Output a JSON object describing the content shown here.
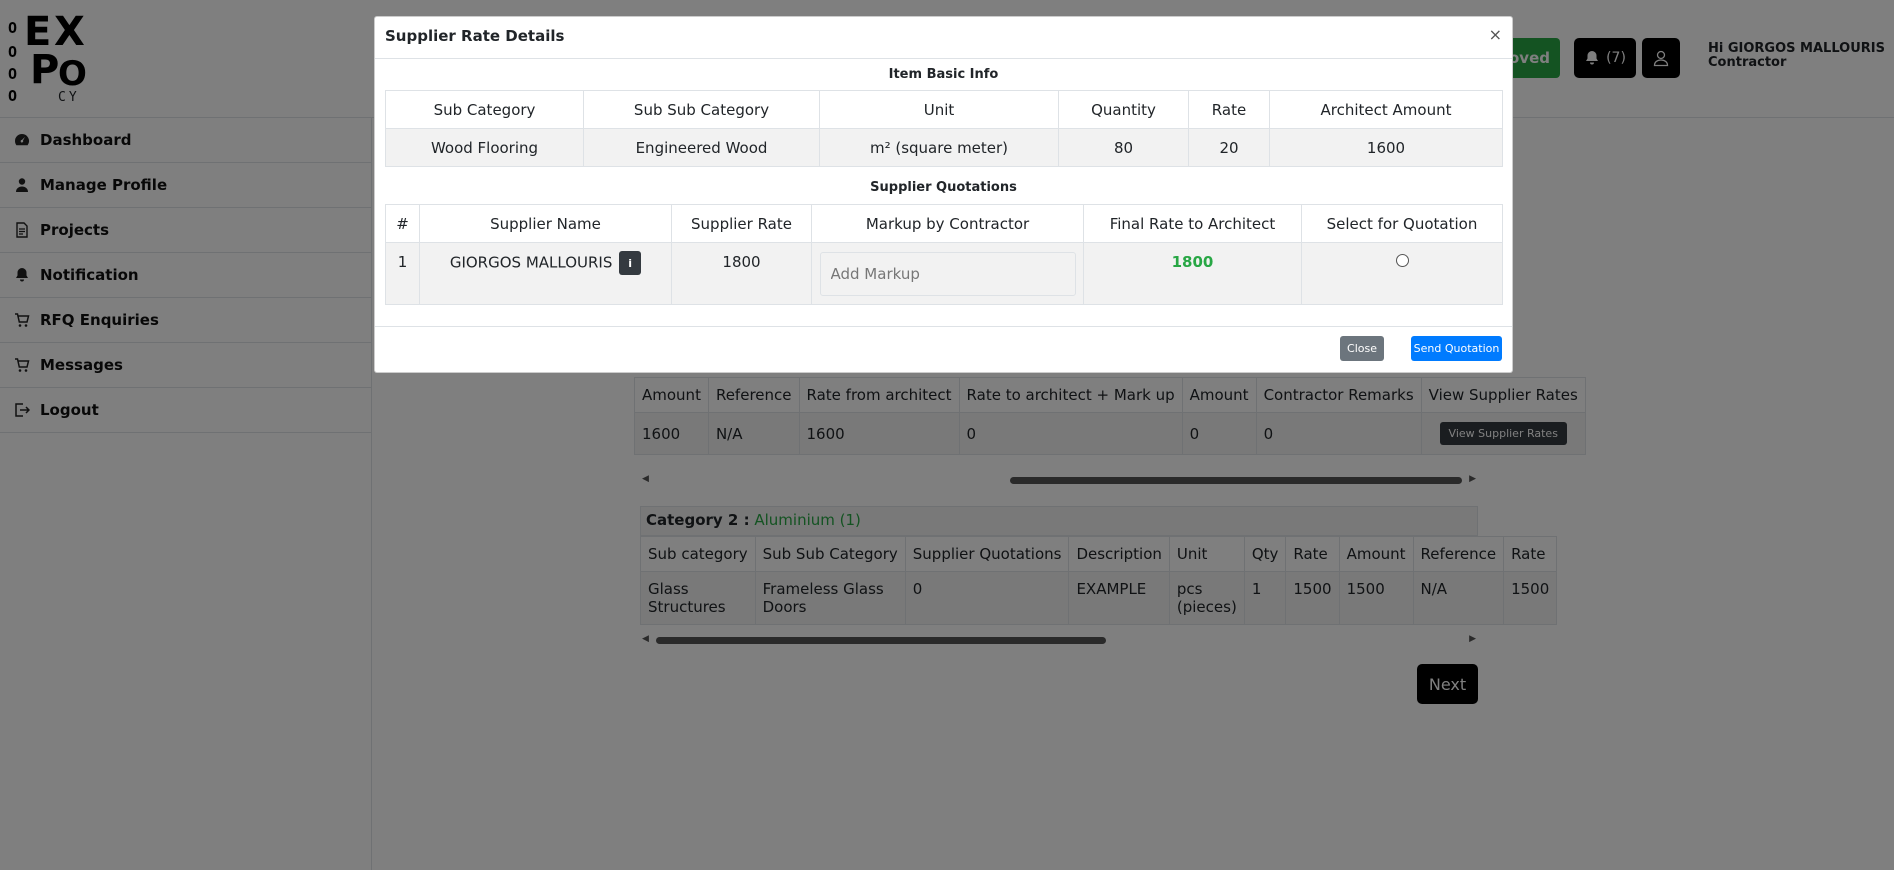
{
  "header": {
    "logo": {
      "row_a": "O",
      "row_b": "O",
      "row_c": "O",
      "row_d": "O",
      "e": "E",
      "x": "X",
      "p": "P",
      "o": "O",
      "cy": "CY"
    },
    "approved_label": "roved",
    "notification_count": "(7)",
    "greeting": "Hi GIORGOS MALLOURIS",
    "role": "Contractor"
  },
  "sidebar": {
    "items": [
      {
        "label": "Dashboard",
        "icon": "dashboard-icon"
      },
      {
        "label": "Manage Profile",
        "icon": "user-icon"
      },
      {
        "label": "Projects",
        "icon": "document-icon"
      },
      {
        "label": "Notification",
        "icon": "bell-icon"
      },
      {
        "label": "RFQ Enquiries",
        "icon": "cart-icon"
      },
      {
        "label": "Messages",
        "icon": "cart-icon"
      },
      {
        "label": "Logout",
        "icon": "logout-icon"
      }
    ]
  },
  "background": {
    "table1": {
      "headers": [
        "Amount",
        "Reference",
        "Rate from architect",
        "Rate to architect + Mark up",
        "Amount",
        "Contractor Remarks",
        "View Supplier Rates"
      ],
      "row": [
        "1600",
        "N/A",
        "1600",
        "0",
        "0",
        "0"
      ],
      "button_label": "View Supplier Rates"
    },
    "category2": {
      "label": "Category 2 :",
      "name": "Aluminium (1)"
    },
    "table2": {
      "headers": [
        "Sub category",
        "Sub Sub Category",
        "Supplier Quotations",
        "Description",
        "Unit",
        "Qty",
        "Rate",
        "Amount",
        "Reference",
        "Rate"
      ],
      "row_line1": [
        "Glass",
        "Frameless Glass",
        "0",
        "EXAMPLE",
        "pcs",
        "1",
        "1500",
        "1500",
        "N/A",
        "1500"
      ],
      "row_line2": [
        "Structures",
        "Doors",
        "",
        "",
        "(pieces)",
        "",
        "",
        "",
        "",
        ""
      ]
    },
    "next_label": "Next"
  },
  "modal": {
    "title": "Supplier Rate Details",
    "close_symbol": "×",
    "basic_info_title": "Item Basic Info",
    "basic_headers": [
      "Sub Category",
      "Sub Sub Category",
      "Unit",
      "Quantity",
      "Rate",
      "Architect Amount"
    ],
    "basic_row": [
      "Wood Flooring",
      "Engineered Wood",
      "m² (square meter)",
      "80",
      "20",
      "1600"
    ],
    "quotations_title": "Supplier Quotations",
    "quote_headers": [
      "#",
      "Supplier Name",
      "Supplier Rate",
      "Markup by Contractor",
      "Final Rate to Architect",
      "Select for Quotation"
    ],
    "quote_row": {
      "index": "1",
      "supplier": "GIORGOS MALLOURIS",
      "info_symbol": "i",
      "rate": "1800",
      "markup_placeholder": "Add Markup",
      "final_rate": "1800"
    },
    "footer": {
      "close_label": "Close",
      "send_label": "Send Quotation"
    }
  },
  "colors": {
    "success": "#28a745",
    "primary": "#007bff",
    "secondary": "#6c757d",
    "dark": "#343a40",
    "overlay": "rgba(0,0,0,0.5)"
  }
}
